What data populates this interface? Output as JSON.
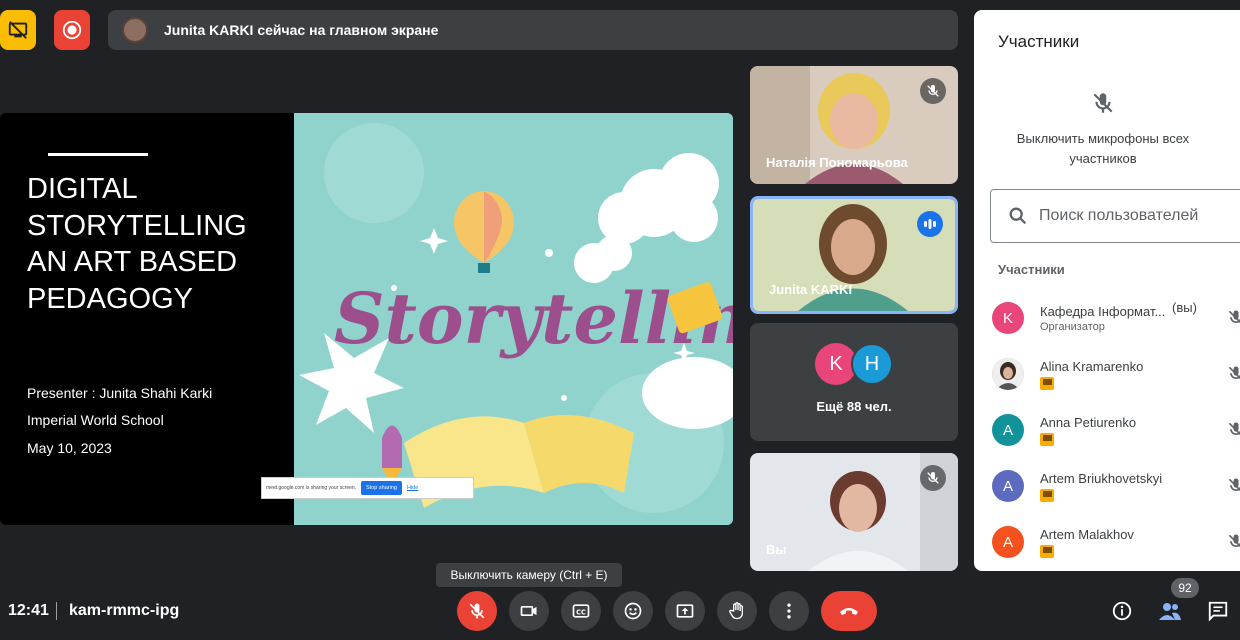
{
  "banner": {
    "text": "Junita KARKI сейчас на главном экране"
  },
  "slide": {
    "title": "DIGITAL STORYTELLING AN ART BASED PEDAGOGY",
    "presenter": "Presenter : Junita Shahi Karki",
    "school": "Imperial World School",
    "date": "May 10, 2023",
    "art_word": "Storytelling",
    "share_bar": {
      "message": "meet.google.com is sharing your screen.",
      "stop_label": "Stop sharing",
      "hide_label": "Hide"
    }
  },
  "tiles": [
    {
      "name": "Наталія Пономарьова",
      "status": "muted"
    },
    {
      "name": "Junita KARKI",
      "status": "speaking"
    },
    {
      "avatars": [
        {
          "letter": "K",
          "color": "#e8457a"
        },
        {
          "letter": "H",
          "color": "#1a9bd7"
        }
      ],
      "more_label": "Ещё 88 чел."
    },
    {
      "name": "Вы",
      "status": "muted"
    }
  ],
  "panel": {
    "title": "Участники",
    "mute_all_label": "Выключить микрофоны всех участников",
    "search_placeholder": "Поиск пользователей",
    "section_label": "Участники",
    "participants": [
      {
        "letter": "K",
        "color": "#e8457a",
        "name": "Кафедра Інформат...",
        "you": "(вы)",
        "role": "Организатор"
      },
      {
        "letter": "",
        "color": "#5f6368",
        "name": "Alina Kramarenko",
        "photo": true
      },
      {
        "letter": "A",
        "color": "#12939a",
        "name": "Anna Petiurenko"
      },
      {
        "letter": "A",
        "color": "#5c6bc0",
        "name": "Artem Briukhovetskyi"
      },
      {
        "letter": "A",
        "color": "#f4511e",
        "name": "Artem Malakhov"
      }
    ]
  },
  "bottom": {
    "time": "12:41",
    "meeting_code": "kam-rmmc-ipg",
    "tooltip": "Выключить камеру (Ctrl + E)",
    "participant_count": "92"
  }
}
